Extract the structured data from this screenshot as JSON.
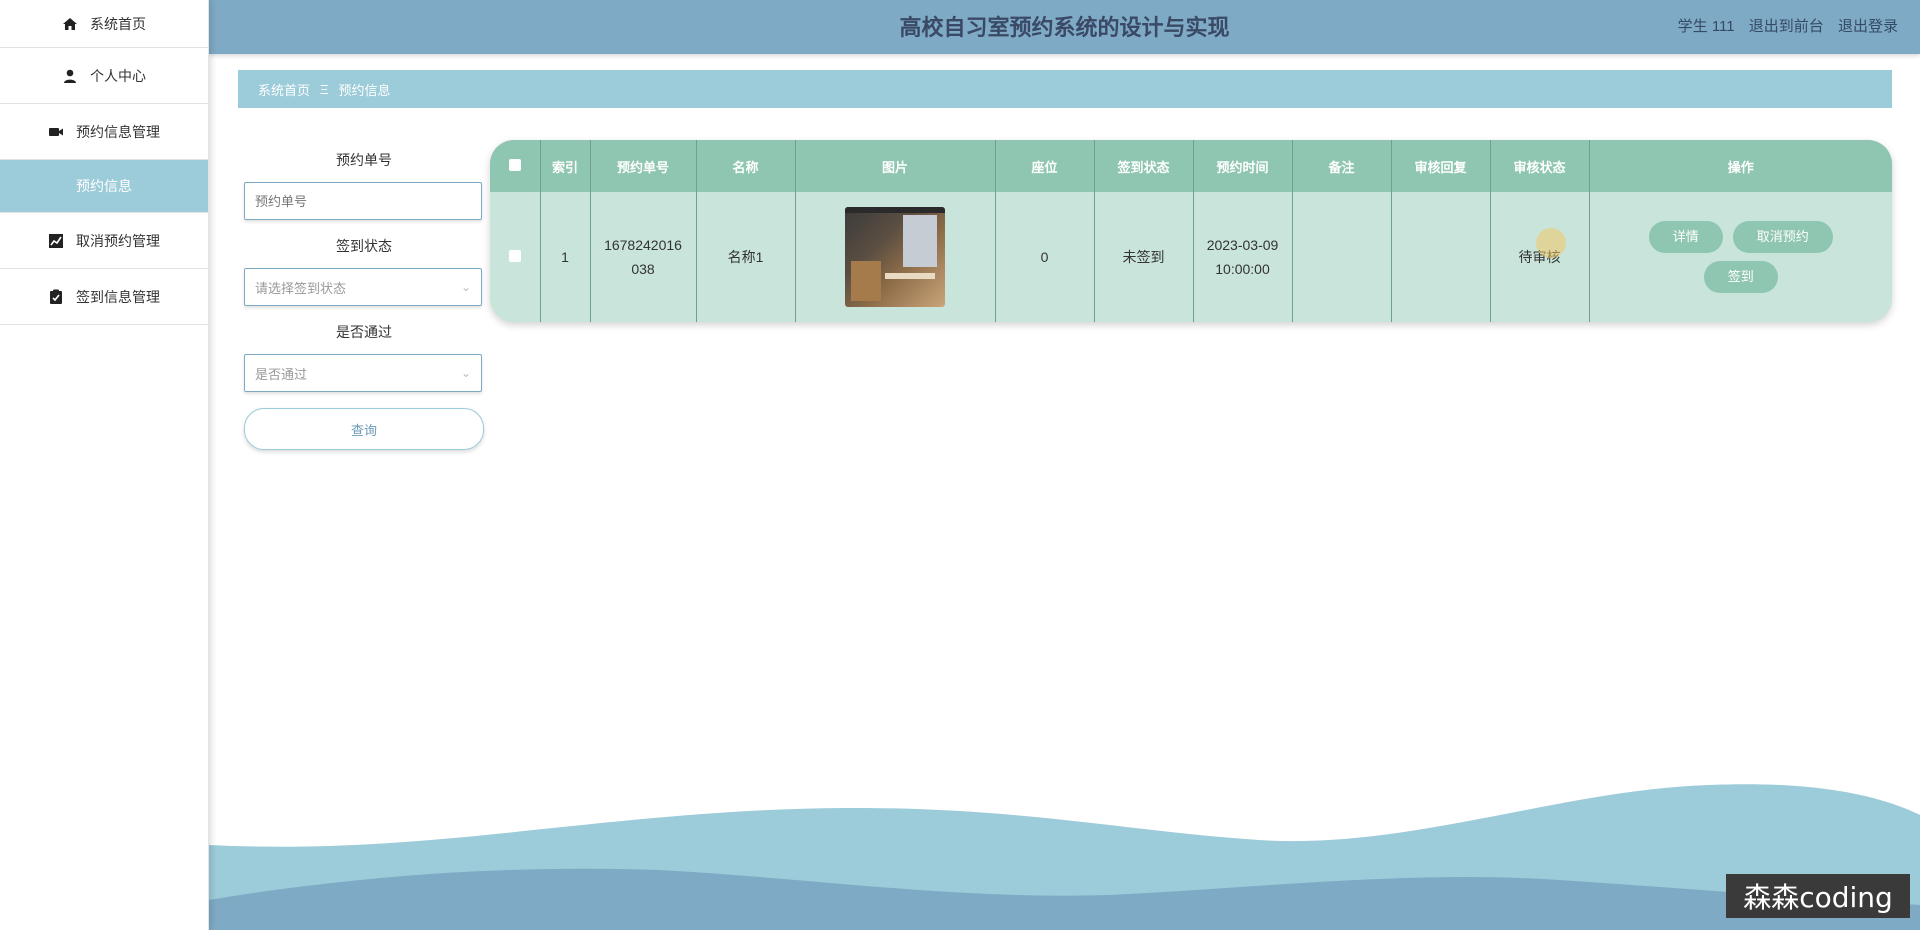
{
  "sidebar": {
    "items": [
      {
        "label": "系统首页",
        "icon": "home-icon"
      },
      {
        "label": "个人中心",
        "icon": "user-icon"
      },
      {
        "label": "预约信息管理",
        "icon": "video-icon"
      },
      {
        "label": "预约信息",
        "icon": ""
      },
      {
        "label": "取消预约管理",
        "icon": "chart-icon"
      },
      {
        "label": "签到信息管理",
        "icon": "clipboard-icon"
      }
    ]
  },
  "header": {
    "title": "高校自习室预约系统的设计与实现",
    "user": "学生 111",
    "to_front": "退出到前台",
    "logout": "退出登录"
  },
  "breadcrumb": {
    "home": "系统首页",
    "separator": "Ξ",
    "current": "预约信息"
  },
  "search": {
    "order_label": "预约单号",
    "order_placeholder": "预约单号",
    "status_label": "签到状态",
    "status_placeholder": "请选择签到状态",
    "pass_label": "是否通过",
    "pass_placeholder": "是否通过",
    "query_button": "查询"
  },
  "table": {
    "headers": [
      "索引",
      "预约单号",
      "名称",
      "图片",
      "座位",
      "签到状态",
      "预约时间",
      "备注",
      "审核回复",
      "审核状态",
      "操作"
    ],
    "rows": [
      {
        "index": "1",
        "order_line1": "1678242016",
        "order_line2": "038",
        "name": "名称1",
        "seat": "0",
        "checkin": "未签到",
        "date": "2023-03-09",
        "time": "10:00:00",
        "remark": "",
        "reply": "",
        "audit": "待审核"
      }
    ],
    "ops": {
      "detail": "详情",
      "cancel": "取消预约",
      "checkin": "签到"
    }
  },
  "watermark": "森森coding",
  "colors": {
    "header": "#7eaac5",
    "accent": "#9ccbd9",
    "table_head": "#8fc6b1",
    "table_row": "#c9e4db"
  }
}
